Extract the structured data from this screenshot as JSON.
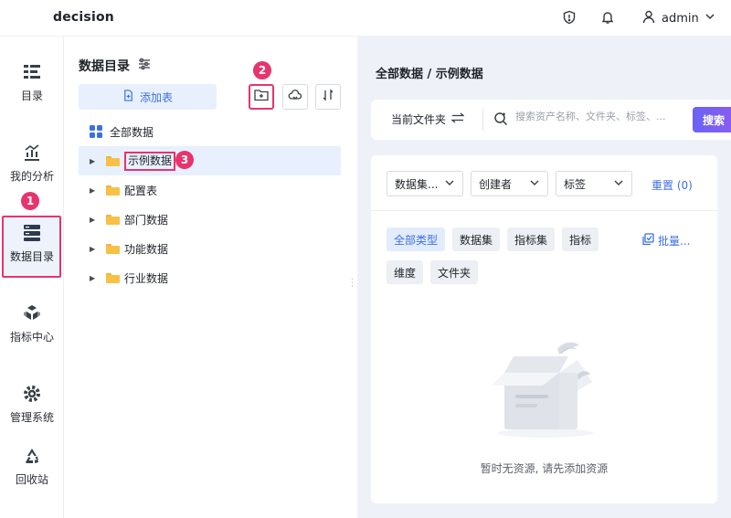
{
  "header": {
    "brand": "decision",
    "user_name": "admin"
  },
  "rail": {
    "items": [
      {
        "label": "目录"
      },
      {
        "label": "我的分析"
      },
      {
        "label": "数据目录"
      },
      {
        "label": "指标中心"
      },
      {
        "label": "管理系统"
      },
      {
        "label": "回收站"
      }
    ],
    "active_index": 2
  },
  "badges": [
    "1",
    "2",
    "3"
  ],
  "catalog": {
    "title": "数据目录",
    "add_table_label": "添加表",
    "tree": [
      {
        "label": "全部数据"
      },
      {
        "label": "示例数据"
      },
      {
        "label": "配置表"
      },
      {
        "label": "部门数据"
      },
      {
        "label": "功能数据"
      },
      {
        "label": "行业数据"
      }
    ]
  },
  "main": {
    "breadcrumb": "全部数据 / 示例数据",
    "current_folder_label": "当前文件夹",
    "search_placeholder": "搜索资产名称、文件夹、标签、...",
    "search_button": "搜索",
    "filters": {
      "type_select": "数据集...",
      "creator_select": "创建者",
      "tag_select": "标签",
      "reset_label": "重置 (0)"
    },
    "type_chips": [
      "全部类型",
      "数据集",
      "指标集",
      "指标",
      "维度",
      "文件夹"
    ],
    "batch_label": "批量...",
    "empty_text": "暂时无资源, 请先添加资源"
  },
  "colors": {
    "accent": "#3d6fe4",
    "highlight": "#e8336d",
    "folder": "#f7c046"
  }
}
